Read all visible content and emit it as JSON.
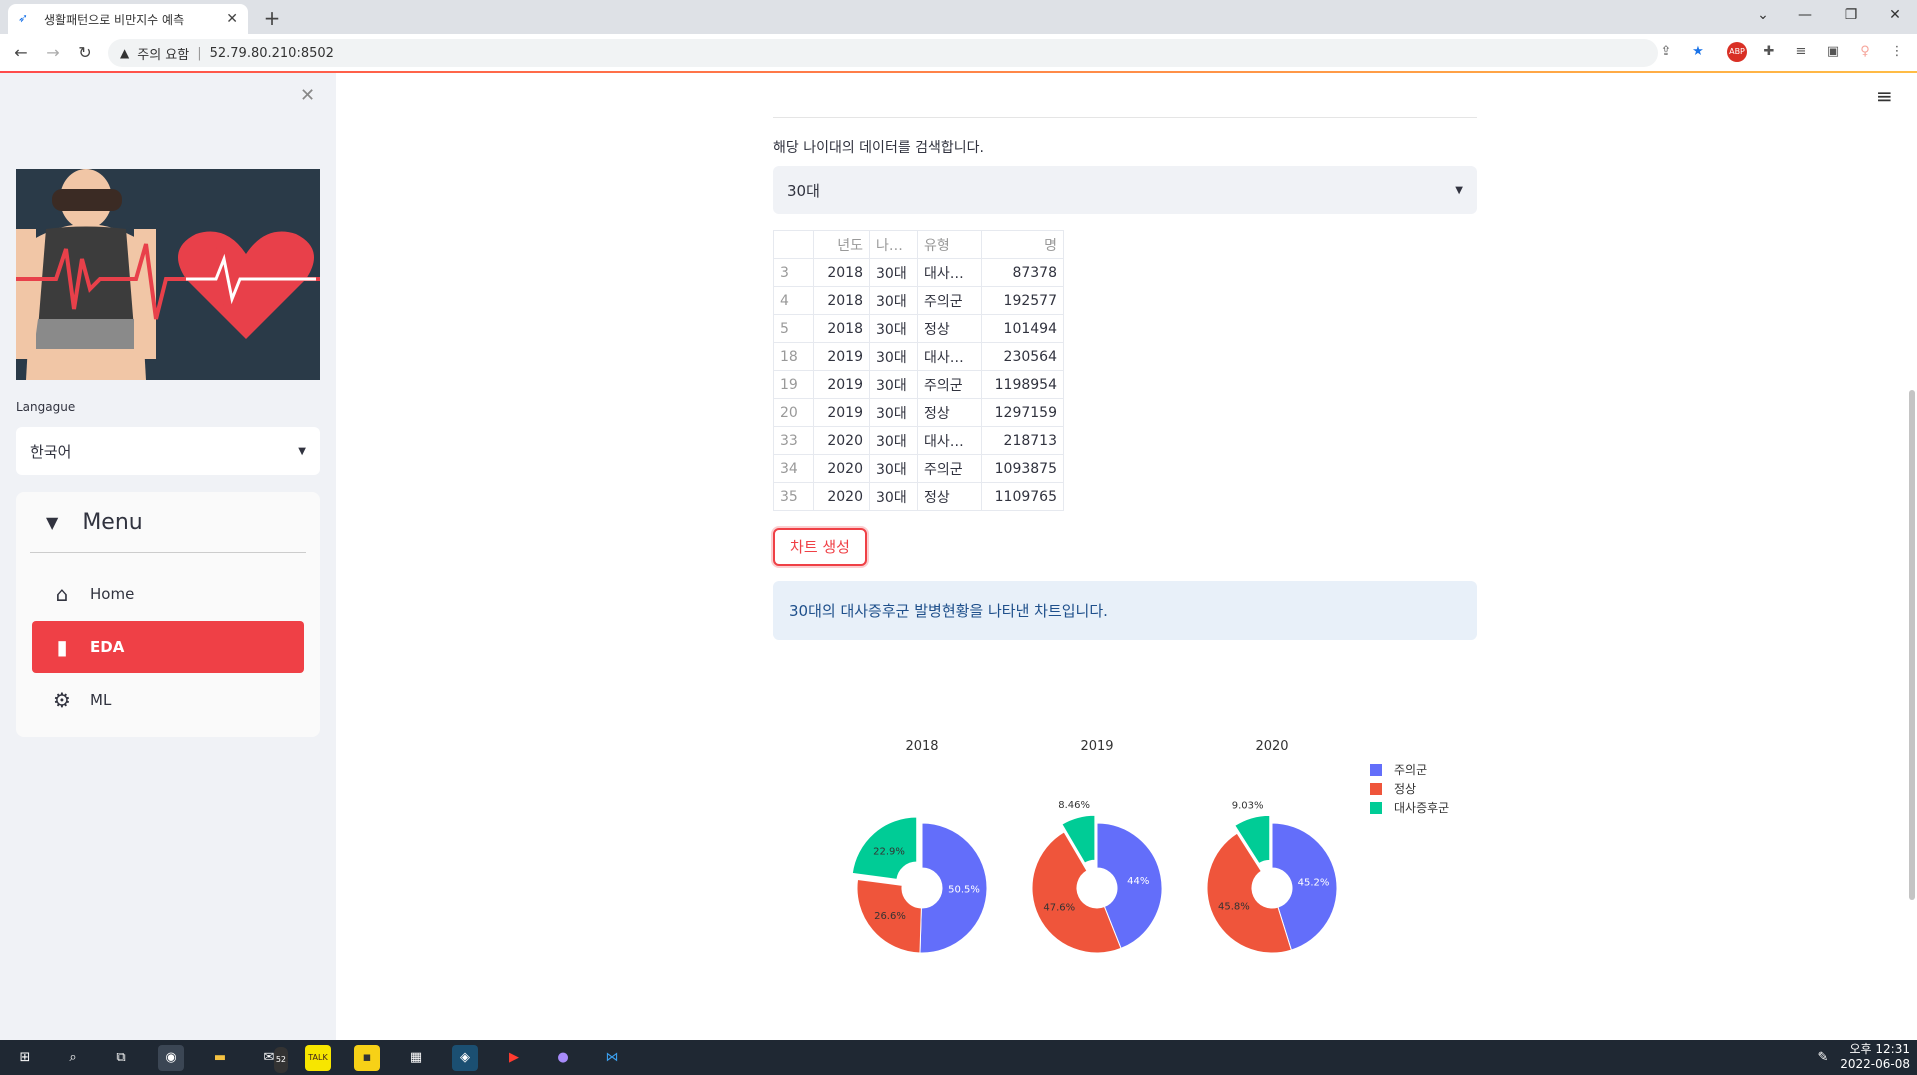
{
  "browser": {
    "tab_title": "생활패턴으로 비만지수 예측",
    "tab_close": "✕",
    "new_tab": "+",
    "security_label": "주의 요함",
    "url": "52.79.80.210:8502"
  },
  "sidebar": {
    "close": "✕",
    "language_label": "Langague",
    "language_value": "한국어",
    "menu_title": "Menu",
    "items": [
      {
        "label": "Home",
        "icon": "home-icon"
      },
      {
        "label": "EDA",
        "icon": "bar-chart-icon"
      },
      {
        "label": "ML",
        "icon": "gear-icon"
      }
    ]
  },
  "main": {
    "search_label": "해당 나이대의 데이터를 검색합니다.",
    "age_value": "30대",
    "table": {
      "headers": [
        "",
        "년도",
        "나…",
        "유형",
        "명"
      ],
      "rows": [
        [
          "3",
          "2018",
          "30대",
          "대사…",
          "87378"
        ],
        [
          "4",
          "2018",
          "30대",
          "주의군",
          "192577"
        ],
        [
          "5",
          "2018",
          "30대",
          "정상",
          "101494"
        ],
        [
          "18",
          "2019",
          "30대",
          "대사…",
          "230564"
        ],
        [
          "19",
          "2019",
          "30대",
          "주의군",
          "1198954"
        ],
        [
          "20",
          "2019",
          "30대",
          "정상",
          "1297159"
        ],
        [
          "33",
          "2020",
          "30대",
          "대사…",
          "218713"
        ],
        [
          "34",
          "2020",
          "30대",
          "주의군",
          "1093875"
        ],
        [
          "35",
          "2020",
          "30대",
          "정상",
          "1109765"
        ]
      ]
    },
    "chart_button": "차트 생성",
    "info_text": "30대의 대사증후군 발병현황을 나타낸 차트입니다."
  },
  "colors": {
    "accent": "#ef4046",
    "series_1": "#636efa",
    "series_2": "#ef553b",
    "series_3": "#00cc96"
  },
  "chart_data": {
    "type": "pie",
    "legend": [
      "주의군",
      "정상",
      "대사증후군"
    ],
    "legend_position": "top-right",
    "hole": true,
    "pies": [
      {
        "title": "2018",
        "values": [
          50.5,
          26.6,
          22.9
        ],
        "labels": [
          "50.5%",
          "26.6%",
          "22.9%"
        ]
      },
      {
        "title": "2019",
        "values": [
          44,
          47.6,
          8.46
        ],
        "labels": [
          "44%",
          "47.6%",
          "8.46%"
        ]
      },
      {
        "title": "2020",
        "values": [
          45.2,
          45.8,
          9.03
        ],
        "labels": [
          "45.2%",
          "45.8%",
          "9.03%"
        ]
      }
    ]
  },
  "taskbar": {
    "time": "오후 12:31",
    "date": "2022-06-08",
    "mail_badge": "52"
  }
}
